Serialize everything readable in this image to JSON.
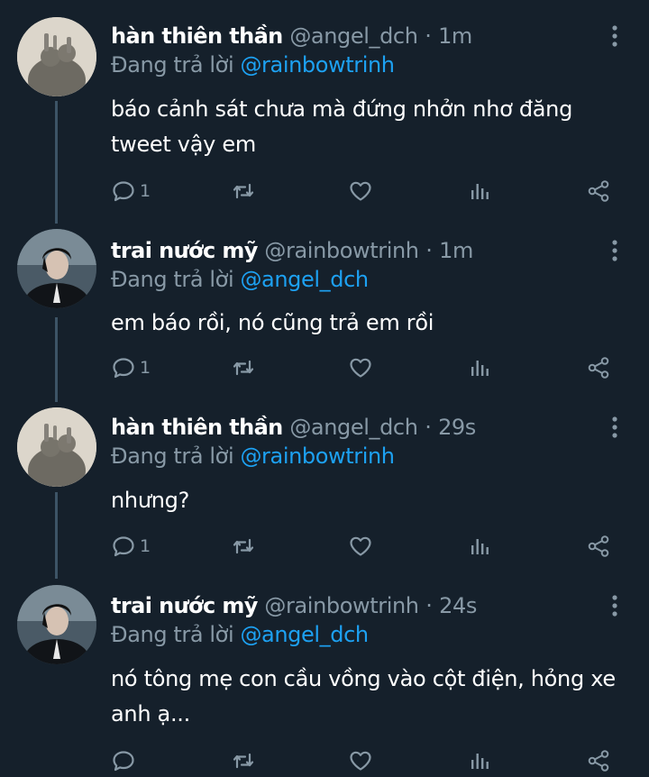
{
  "replying_prefix": "Đang trả lời",
  "tweets": [
    {
      "display_name": "hàn thiên thần",
      "handle": "@angel_dch",
      "separator": "·",
      "time": "1m",
      "reply_to": "@rainbowtrinh",
      "text_lines": [
        "báo cảnh sát chưa mà đứng nhởn nhơ đăng",
        "tweet vậy em"
      ],
      "reply_count": "1",
      "avatar": "pale-shadow-avatar"
    },
    {
      "display_name": "trai nước mỹ",
      "handle": "@rainbowtrinh",
      "separator": "·",
      "time": "1m",
      "reply_to": "@angel_dch",
      "text_lines": [
        "em báo rồi, nó cũng trả em rồi"
      ],
      "reply_count": "1",
      "avatar": "dark-portrait-avatar"
    },
    {
      "display_name": "hàn thiên thần",
      "handle": "@angel_dch",
      "separator": "·",
      "time": "29s",
      "reply_to": "@rainbowtrinh",
      "text_lines": [
        "nhưng?"
      ],
      "reply_count": "1",
      "avatar": "pale-shadow-avatar"
    },
    {
      "display_name": "trai nước mỹ",
      "handle": "@rainbowtrinh",
      "separator": "·",
      "time": "24s",
      "reply_to": "@angel_dch",
      "text_lines": [
        "nó tông mẹ con cầu vồng vào cột điện, hỏng xe",
        "anh ạ..."
      ],
      "reply_count": "",
      "avatar": "dark-portrait-avatar"
    }
  ],
  "icons": {
    "reply": "reply-bubble-icon",
    "retweet": "retweet-icon",
    "like": "heart-icon",
    "analytics": "analytics-icon",
    "share": "share-icon",
    "more": "more-vertical-icon"
  },
  "colors": {
    "background": "#15202b",
    "text": "#ffffff",
    "secondary": "#8899a6",
    "mention": "#1da1f2",
    "thread_line": "#3d5466"
  }
}
